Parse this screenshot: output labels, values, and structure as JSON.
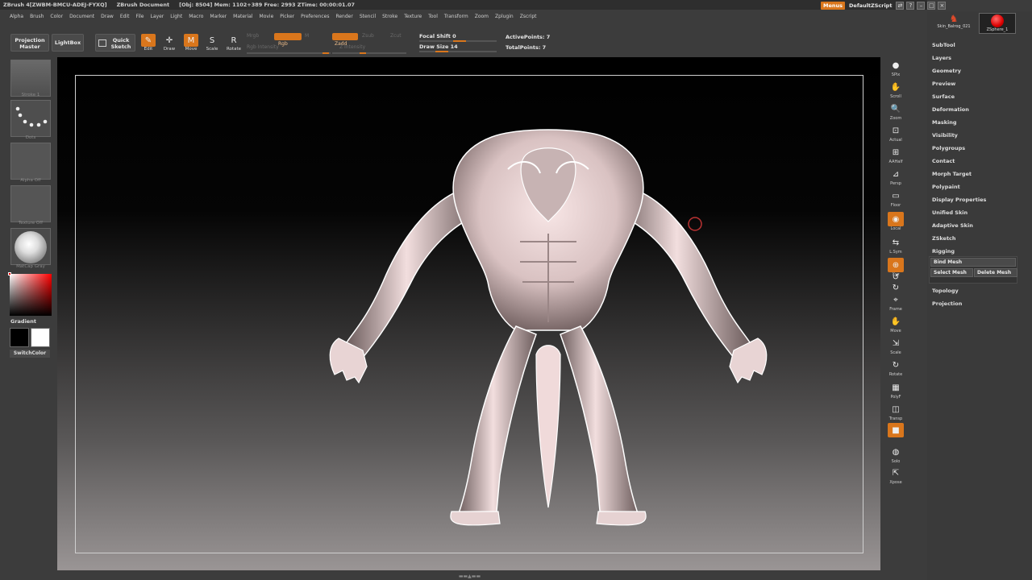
{
  "titlebar": {
    "app": "ZBrush 4[ZWBM-BMCU-ADEJ-FYXQ]",
    "doc": "ZBrush Document",
    "stats": "[Obj: 8504] Mem: 1102+389  Free: 2993  ZTime: 00:00:01.07"
  },
  "menus": [
    "Alpha",
    "Brush",
    "Color",
    "Document",
    "Draw",
    "Edit",
    "File",
    "Layer",
    "Light",
    "Macro",
    "Marker",
    "Material",
    "Movie",
    "Picker",
    "Preferences",
    "Render",
    "Stencil",
    "Stroke",
    "Texture",
    "Tool",
    "Transform",
    "Zoom",
    "Zplugin",
    "Zscript"
  ],
  "topright": {
    "menus_label": "Menus",
    "zscript_label": "DefaultZScript"
  },
  "toolbar": {
    "projection_master": "Projection Master",
    "lightbox": "LightBox",
    "quick_sketch": "Quick Sketch",
    "edit": "Edit",
    "draw": "Draw",
    "move": "Move",
    "scale": "Scale",
    "rotate": "Rotate",
    "mrgb": "Mrgb",
    "rgb": "Rgb",
    "m": "M",
    "zadd": "Zadd",
    "zsub": "Zsub",
    "zcut": "Zcut",
    "rgb_intensity": "Rgb Intensity",
    "z_intensity": "Z Intensity",
    "focal_shift": "Focal Shift 0",
    "draw_size": "Draw Size 14",
    "active_points": "ActivePoints: 7",
    "total_points": "TotalPoints: 7"
  },
  "leftshelf": {
    "stroke": "Stroke 1",
    "dots": "Dots",
    "alpha": "Alpha Off",
    "texture": "Texture Off",
    "matcap": "MatCap Gray",
    "gradient": "Gradient",
    "switchcolor": "SwitchColor"
  },
  "rightshelf": [
    "SPix",
    "Scroll",
    "Zoom",
    "Actual",
    "AAHalf",
    "Persp",
    "Floor",
    "Local",
    "L.Sym",
    "Xyz",
    "",
    "",
    "Frame",
    "Move",
    "Scale",
    "Rotate",
    "PolyF",
    "Transp",
    "",
    "Solo",
    "Xpose"
  ],
  "palette": {
    "tool1": "Skin_Balrog_021",
    "tool2": "ZSphere_1",
    "items": [
      "SubTool",
      "Layers",
      "Geometry",
      "Preview",
      "Surface",
      "Deformation",
      "Masking",
      "Visibility",
      "Polygroups",
      "Contact",
      "Morph Target",
      "Polypaint",
      "Display Properties",
      "Unified Skin",
      "Adaptive Skin",
      "ZSketch",
      "Rigging"
    ],
    "bind_mesh": "Bind Mesh",
    "select_mesh": "Select Mesh",
    "delete_mesh": "Delete Mesh",
    "topology": "Topology",
    "projection": "Projection"
  },
  "colors": {
    "accent": "#d9761c",
    "panel": "#3c3c3c"
  }
}
